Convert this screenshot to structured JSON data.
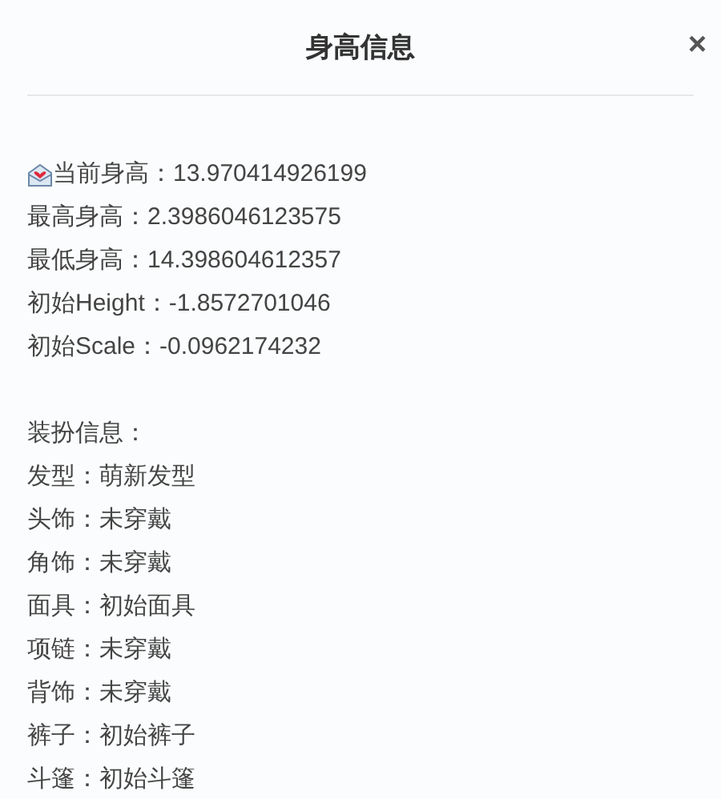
{
  "dialog": {
    "title": "身高信息",
    "close": "×"
  },
  "height_info": [
    {
      "text": "当前身高：13.970414926199",
      "kind": "icon"
    },
    {
      "text": "最高身高：2.3986046123575",
      "kind": "plain"
    },
    {
      "text": "最低身高：14.398604612357",
      "kind": "plain"
    },
    {
      "text": "初始Height：-1.8572701046",
      "kind": "plain"
    },
    {
      "text": "初始Scale：-0.0962174232",
      "kind": "plain"
    }
  ],
  "outfit_heading": "装扮信息：",
  "outfit": [
    "发型：萌新发型",
    "头饰：未穿戴",
    "角饰：未穿戴",
    "面具：初始面具",
    "项链：未穿戴",
    "背饰：未穿戴",
    "裤子：初始裤子",
    "斗篷：初始斗篷"
  ]
}
